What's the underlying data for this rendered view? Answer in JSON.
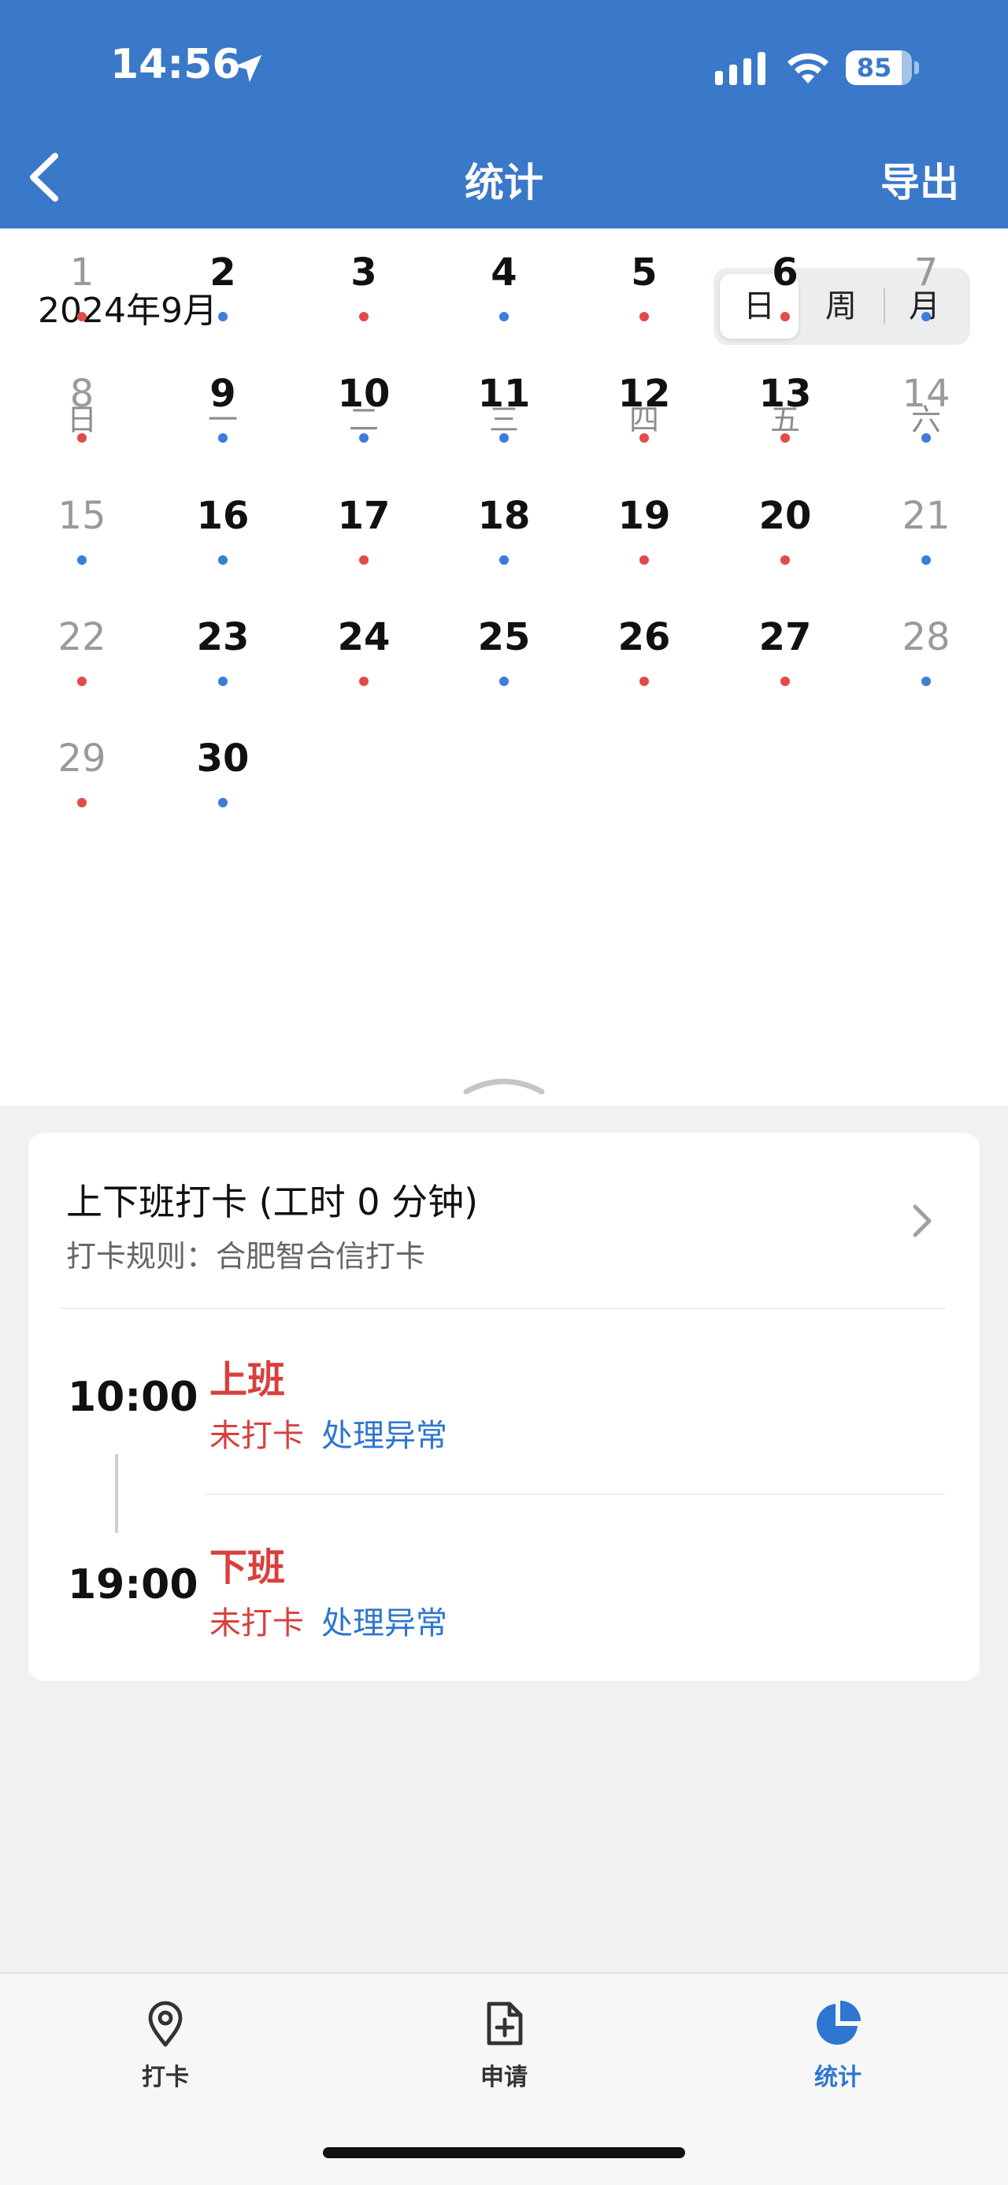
{
  "status_bar": {
    "time": "14:56",
    "battery": "85",
    "battery_level": 0.85
  },
  "header": {
    "title": "统计",
    "export_label": "导出"
  },
  "calendar": {
    "month_label": "2024年9月",
    "view_tabs": [
      "日",
      "周",
      "月"
    ],
    "active_view": "日",
    "weekdays": [
      "日",
      "一",
      "二",
      "三",
      "四",
      "五",
      "六"
    ],
    "status_colors": {
      "red": "#e24b4b",
      "blue": "#3b7ddb"
    },
    "days": [
      {
        "day": "1",
        "col": 0,
        "row": 0,
        "dot": "red"
      },
      {
        "day": "2",
        "col": 1,
        "row": 0,
        "dot": "blue"
      },
      {
        "day": "3",
        "col": 2,
        "row": 0,
        "dot": "red"
      },
      {
        "day": "4",
        "col": 3,
        "row": 0,
        "dot": "blue"
      },
      {
        "day": "5",
        "col": 4,
        "row": 0,
        "dot": "red"
      },
      {
        "day": "6",
        "col": 5,
        "row": 0,
        "dot": "red"
      },
      {
        "day": "7",
        "col": 6,
        "row": 0,
        "dot": "blue"
      },
      {
        "day": "8",
        "col": 0,
        "row": 1,
        "dot": "red"
      },
      {
        "day": "9",
        "col": 1,
        "row": 1,
        "dot": "blue"
      },
      {
        "day": "10",
        "col": 2,
        "row": 1,
        "dot": "blue"
      },
      {
        "day": "11",
        "col": 3,
        "row": 1,
        "dot": "blue"
      },
      {
        "day": "12",
        "col": 4,
        "row": 1,
        "dot": "red"
      },
      {
        "day": "13",
        "col": 5,
        "row": 1,
        "dot": "red"
      },
      {
        "day": "14",
        "col": 6,
        "row": 1,
        "dot": "blue"
      },
      {
        "day": "15",
        "col": 0,
        "row": 2,
        "dot": "blue"
      },
      {
        "day": "16",
        "col": 1,
        "row": 2,
        "dot": "blue"
      },
      {
        "day": "17",
        "col": 2,
        "row": 2,
        "dot": "red"
      },
      {
        "day": "18",
        "col": 3,
        "row": 2,
        "dot": "blue"
      },
      {
        "day": "19",
        "col": 4,
        "row": 2,
        "dot": "red"
      },
      {
        "day": "20",
        "col": 5,
        "row": 2,
        "dot": "red"
      },
      {
        "day": "21",
        "col": 6,
        "row": 2,
        "dot": "blue"
      },
      {
        "day": "22",
        "col": 0,
        "row": 3,
        "dot": "red"
      },
      {
        "day": "23",
        "col": 1,
        "row": 3,
        "dot": "blue"
      },
      {
        "day": "24",
        "col": 2,
        "row": 3,
        "dot": "red"
      },
      {
        "day": "25",
        "col": 3,
        "row": 3,
        "dot": "blue"
      },
      {
        "day": "26",
        "col": 4,
        "row": 3,
        "dot": "red"
      },
      {
        "day": "27",
        "col": 5,
        "row": 3,
        "dot": "red"
      },
      {
        "day": "28",
        "col": 6,
        "row": 3,
        "dot": "blue"
      },
      {
        "day": "29",
        "col": 0,
        "row": 4,
        "dot": "red"
      },
      {
        "day": "30",
        "col": 1,
        "row": 4,
        "dot": "blue"
      }
    ]
  },
  "attendance": {
    "title": "上下班打卡 (工时 0 分钟)",
    "rule": "打卡规则：合肥智合信打卡",
    "entries": [
      {
        "time": "10:00",
        "shift": "上班",
        "status": "未打卡",
        "action": "处理异常"
      },
      {
        "time": "19:00",
        "shift": "下班",
        "status": "未打卡",
        "action": "处理异常"
      }
    ]
  },
  "tabbar": {
    "items": [
      {
        "label": "打卡",
        "icon": "location-pin-icon"
      },
      {
        "label": "申请",
        "icon": "add-document-icon"
      },
      {
        "label": "统计",
        "icon": "pie-chart-icon"
      }
    ],
    "active": "统计"
  }
}
